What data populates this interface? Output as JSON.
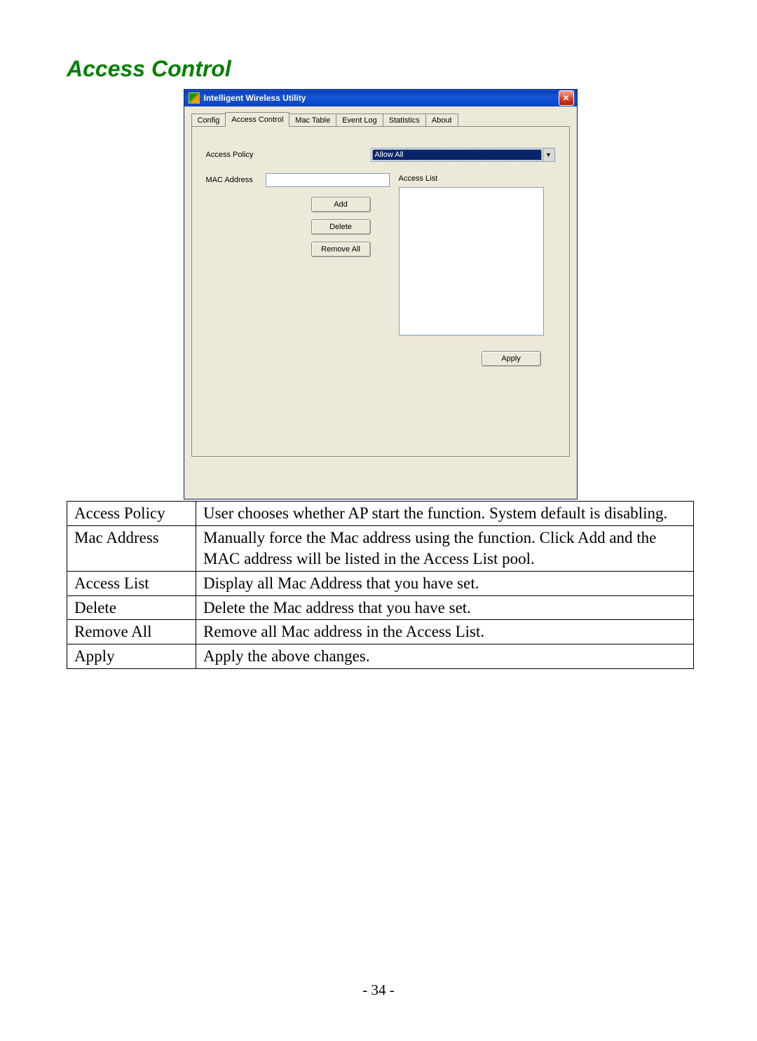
{
  "heading": "Access Control",
  "window": {
    "title": "Intelligent Wireless Utility",
    "close_glyph": "✕",
    "tabs": [
      "Config",
      "Access Control",
      "Mac Table",
      "Event Log",
      "Statistics",
      "About"
    ],
    "active_tab_index": 1,
    "labels": {
      "access_policy": "Access Policy",
      "mac_address": "MAC Address",
      "access_list": "Access List"
    },
    "policy_value": "Allow All",
    "dropdown_arrow": "▼",
    "buttons": {
      "add": "Add",
      "delete": "Delete",
      "remove_all": "Remove All",
      "apply": "Apply"
    }
  },
  "table": [
    {
      "term": "Access Policy",
      "desc": "User chooses whether AP start the function. System default is disabling."
    },
    {
      "term": "Mac Address",
      "desc": "Manually force the Mac address using the function. Click Add and the MAC address will be listed in the Access List pool."
    },
    {
      "term": "Access List",
      "desc": "Display all Mac Address that you have set."
    },
    {
      "term": "Delete",
      "desc": "Delete the Mac address that you have set."
    },
    {
      "term": "Remove All",
      "desc": "Remove all Mac address in the Access List."
    },
    {
      "term": "Apply",
      "desc": "Apply the above changes."
    }
  ],
  "page_number": "- 34 -"
}
